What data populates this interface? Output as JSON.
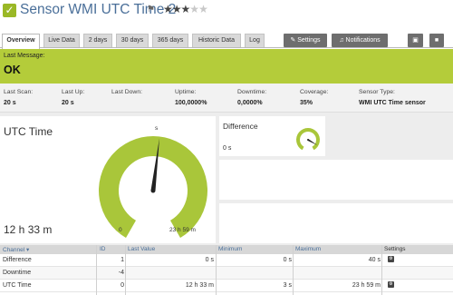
{
  "header": {
    "title": "Sensor WMI UTC Time 2",
    "check_icon": "checkmark-icon",
    "flag_icon": "flag-icon",
    "priority_stars": 3,
    "max_stars": 5,
    "accent_color": "#9ab826",
    "title_color": "#4a6f99"
  },
  "tabs": [
    {
      "label": "Overview",
      "active": true
    },
    {
      "label": "Live Data",
      "active": false
    },
    {
      "label": "2 days",
      "active": false
    },
    {
      "label": "30 days",
      "active": false
    },
    {
      "label": "365 days",
      "active": false
    },
    {
      "label": "Historic Data",
      "active": false
    },
    {
      "label": "Log",
      "active": false
    }
  ],
  "toolbar": {
    "settings_label": "Settings",
    "settings_icon": "wrench-icon",
    "notifications_label": "Notifications",
    "notifications_icon": "bell-icon",
    "extra_icon_1": "screen-icon",
    "extra_icon_2": "trash-icon"
  },
  "message": {
    "label": "Last Message:",
    "text": "OK",
    "color": "#b4cc3a"
  },
  "stats": [
    {
      "label": "Last Scan:",
      "value": "20 s"
    },
    {
      "label": "Last Up:",
      "value": "20 s"
    },
    {
      "label": "Last Down:",
      "value": ""
    },
    {
      "label": "Uptime:",
      "value": "100,0000%"
    },
    {
      "label": "Downtime:",
      "value": "0,0000%"
    },
    {
      "label": "Coverage:",
      "value": "35%"
    },
    {
      "label": "Sensor Type:",
      "value": "WMI UTC Time sensor"
    }
  ],
  "main_gauge": {
    "title": "UTC Time",
    "value": "12 h 33 m",
    "min_label": "0",
    "max_label": "23 h 59 m",
    "top_label": "s",
    "fraction": 0.523,
    "color": "#a9c63a"
  },
  "small_gauge": {
    "title": "Difference",
    "value": "0 s",
    "fraction": 0.9,
    "color": "#a9c63a"
  },
  "table": {
    "headers": [
      "Channel",
      "ID",
      "Last Value",
      "Minimum",
      "Maximum",
      "Settings"
    ],
    "rows": [
      {
        "channel": "Difference",
        "id": "1",
        "last": "0 s",
        "min": "0 s",
        "max": "40 s",
        "settings": "gear"
      },
      {
        "channel": "Downtime",
        "id": "-4",
        "last": "",
        "min": "",
        "max": "",
        "settings": ""
      },
      {
        "channel": "UTC Time",
        "id": "0",
        "last": "12 h 33 m",
        "min": "3 s",
        "max": "23 h 59 m",
        "settings": "gear"
      }
    ]
  }
}
